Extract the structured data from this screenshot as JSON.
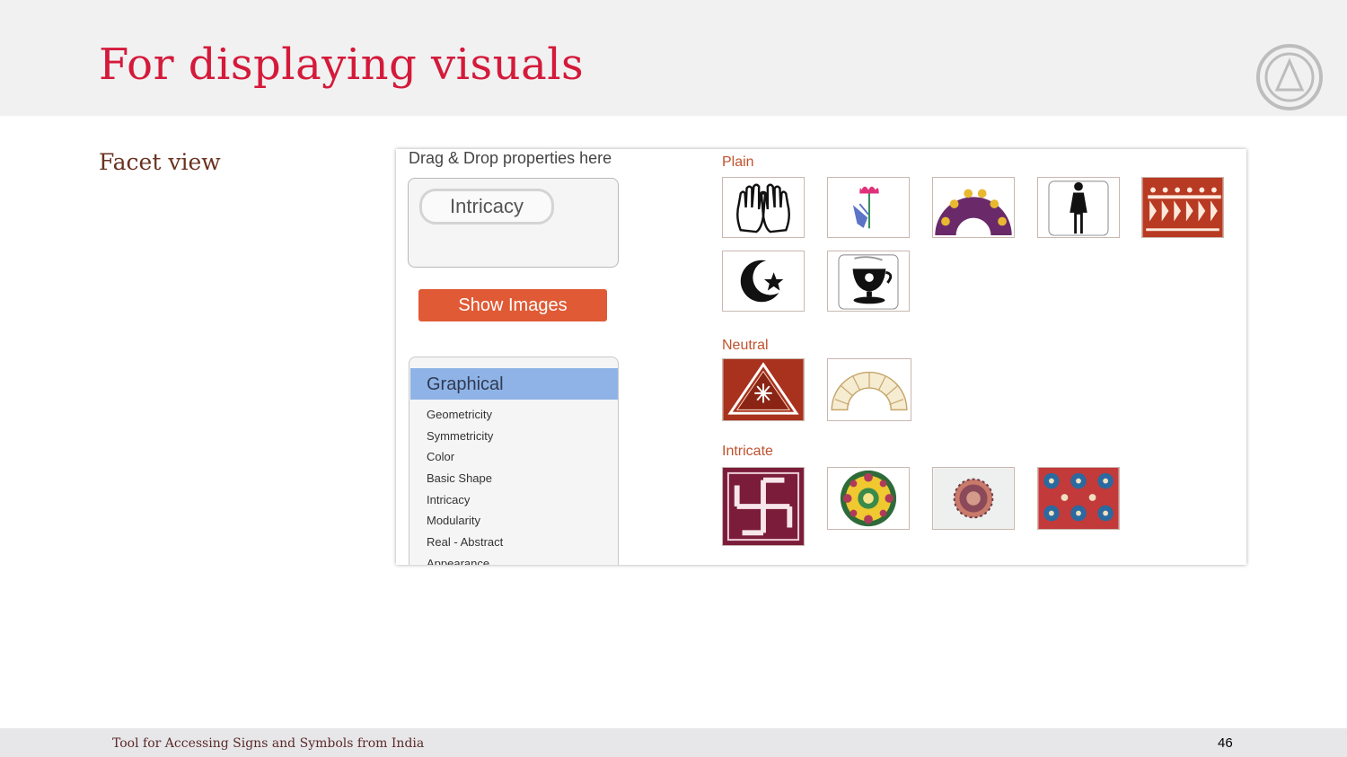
{
  "slide": {
    "title": "For displaying visuals",
    "subtitle": "Facet view",
    "footer_text": "Tool for Accessing Signs and Symbols from India",
    "page_number": "46"
  },
  "panel": {
    "drag_drop_label": "Drag & Drop properties here",
    "selected_chip": "Intricacy",
    "show_images_label": "Show Images",
    "facet_group": "Graphical",
    "facet_items": [
      "Geometricity",
      "Symmetricity",
      "Color",
      "Basic Shape",
      "Intricacy",
      "Modularity",
      "Real - Abstract",
      "Appearance"
    ]
  },
  "results": {
    "plain_label": "Plain",
    "neutral_label": "Neutral",
    "intricate_label": "Intricate",
    "plain_images": [
      "open-palms-icon",
      "lotus-hand-icon",
      "arch-motif-icon",
      "woman-figure-icon",
      "warli-dancers-icon",
      "crescent-star-icon",
      "teacup-icon"
    ],
    "neutral_images": [
      "triangle-rangoli-icon",
      "fan-arch-icon"
    ],
    "intricate_images": [
      "swastika-icon",
      "mandala-icon",
      "embroidery-medallion-icon",
      "tile-pattern-icon"
    ]
  },
  "colors": {
    "title": "#d41a3a",
    "accent_button": "#e05a35",
    "facet_header": "#8fb3e6",
    "section_label": "#c0522e"
  }
}
